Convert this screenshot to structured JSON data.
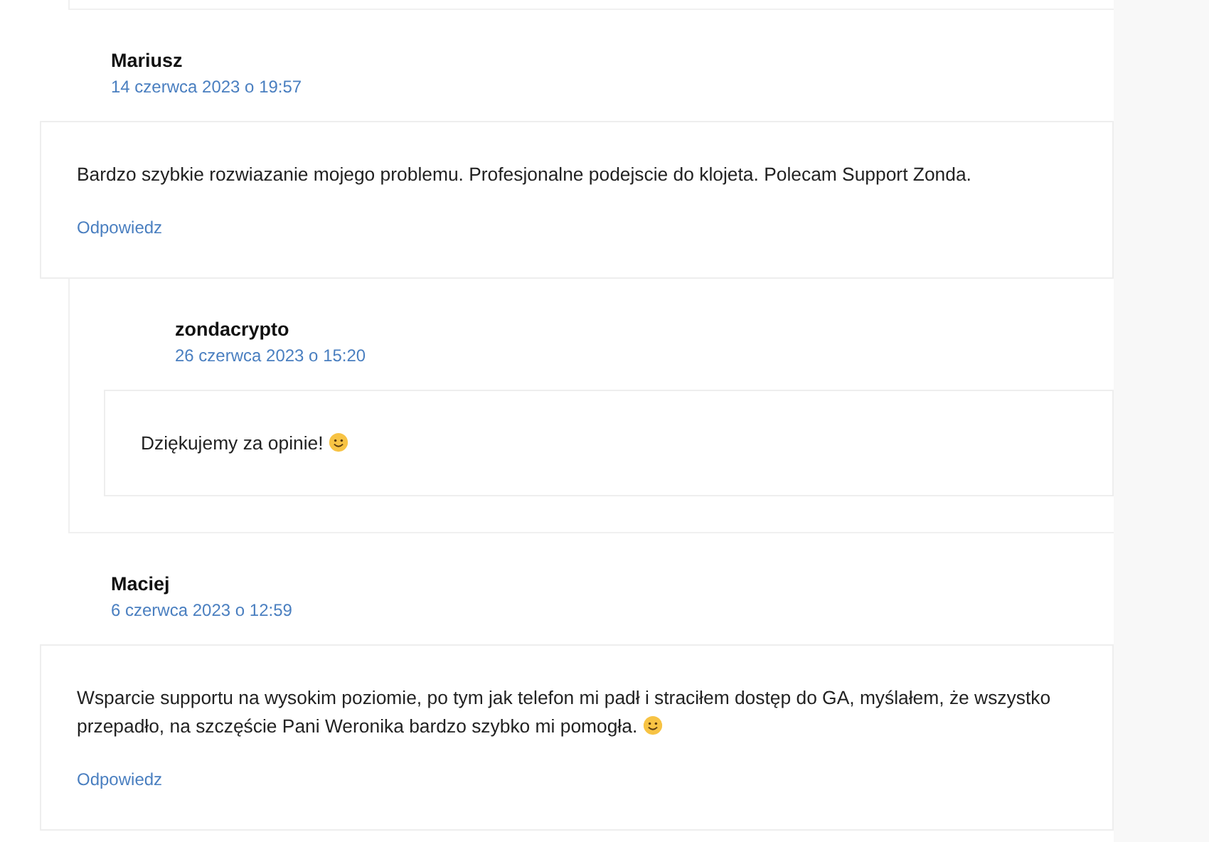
{
  "comments": [
    {
      "author": "Mariusz",
      "date": "14 czerwca 2023 o 19:57",
      "text": "Bardzo szybkie rozwiazanie mojego problemu. Profesjonalne podejscie do klojeta. Polecam Support Zonda.",
      "emoji": false,
      "reply_link": "Odpowiedz",
      "children": [
        {
          "author": "zondacrypto",
          "date": "26 czerwca 2023 o 15:20",
          "text": "Dziękujemy za opinie!",
          "emoji": true
        }
      ]
    },
    {
      "author": "Maciej",
      "date": "6 czerwca 2023 o 12:59",
      "text": "Wsparcie supportu na wysokim poziomie, po tym jak telefon mi padł i straciłem dostęp do GA, myślałem, że wszystko przepadło, na szczęście Pani Weronika bardzo szybko mi pomogła.",
      "emoji": true,
      "reply_link": "Odpowiedz"
    }
  ]
}
